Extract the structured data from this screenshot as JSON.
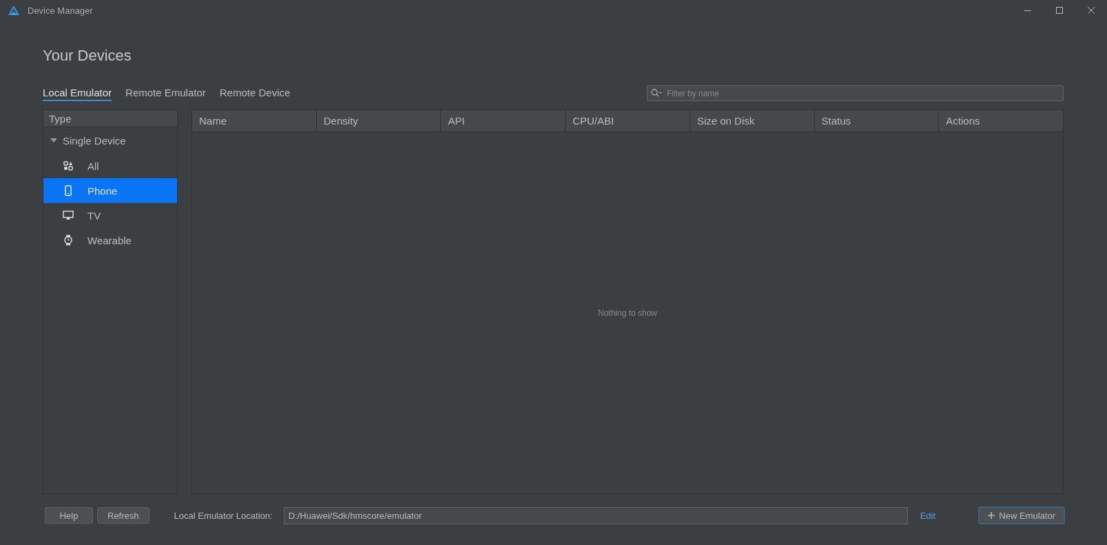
{
  "window": {
    "title": "Device Manager"
  },
  "heading": "Your Devices",
  "tabs": [
    {
      "label": "Local Emulator",
      "selected": true
    },
    {
      "label": "Remote Emulator",
      "selected": false
    },
    {
      "label": "Remote Device",
      "selected": false
    }
  ],
  "search": {
    "placeholder": "Filter by name"
  },
  "type_panel": {
    "header": "Type",
    "tree": [
      {
        "label": "Single Device",
        "expanded": true,
        "children": [
          {
            "label": "All",
            "kind": "all",
            "selected": false
          },
          {
            "label": "Phone",
            "kind": "phone",
            "selected": true
          },
          {
            "label": "TV",
            "kind": "tv",
            "selected": false
          },
          {
            "label": "Wearable",
            "kind": "wearable",
            "selected": false
          }
        ]
      }
    ]
  },
  "table": {
    "columns": [
      "Name",
      "Density",
      "API",
      "CPU/ABI",
      "Size on Disk",
      "Status",
      "Actions"
    ],
    "empty_message": "Nothing to show"
  },
  "footer": {
    "buttons": [
      "Help",
      "Refresh"
    ],
    "location_label": "Local Emulator Location:",
    "location_value": "D:/Huawei/Sdk/hmscore/emulator",
    "edit_link": "Edit",
    "new_button": "New Emulator"
  }
}
